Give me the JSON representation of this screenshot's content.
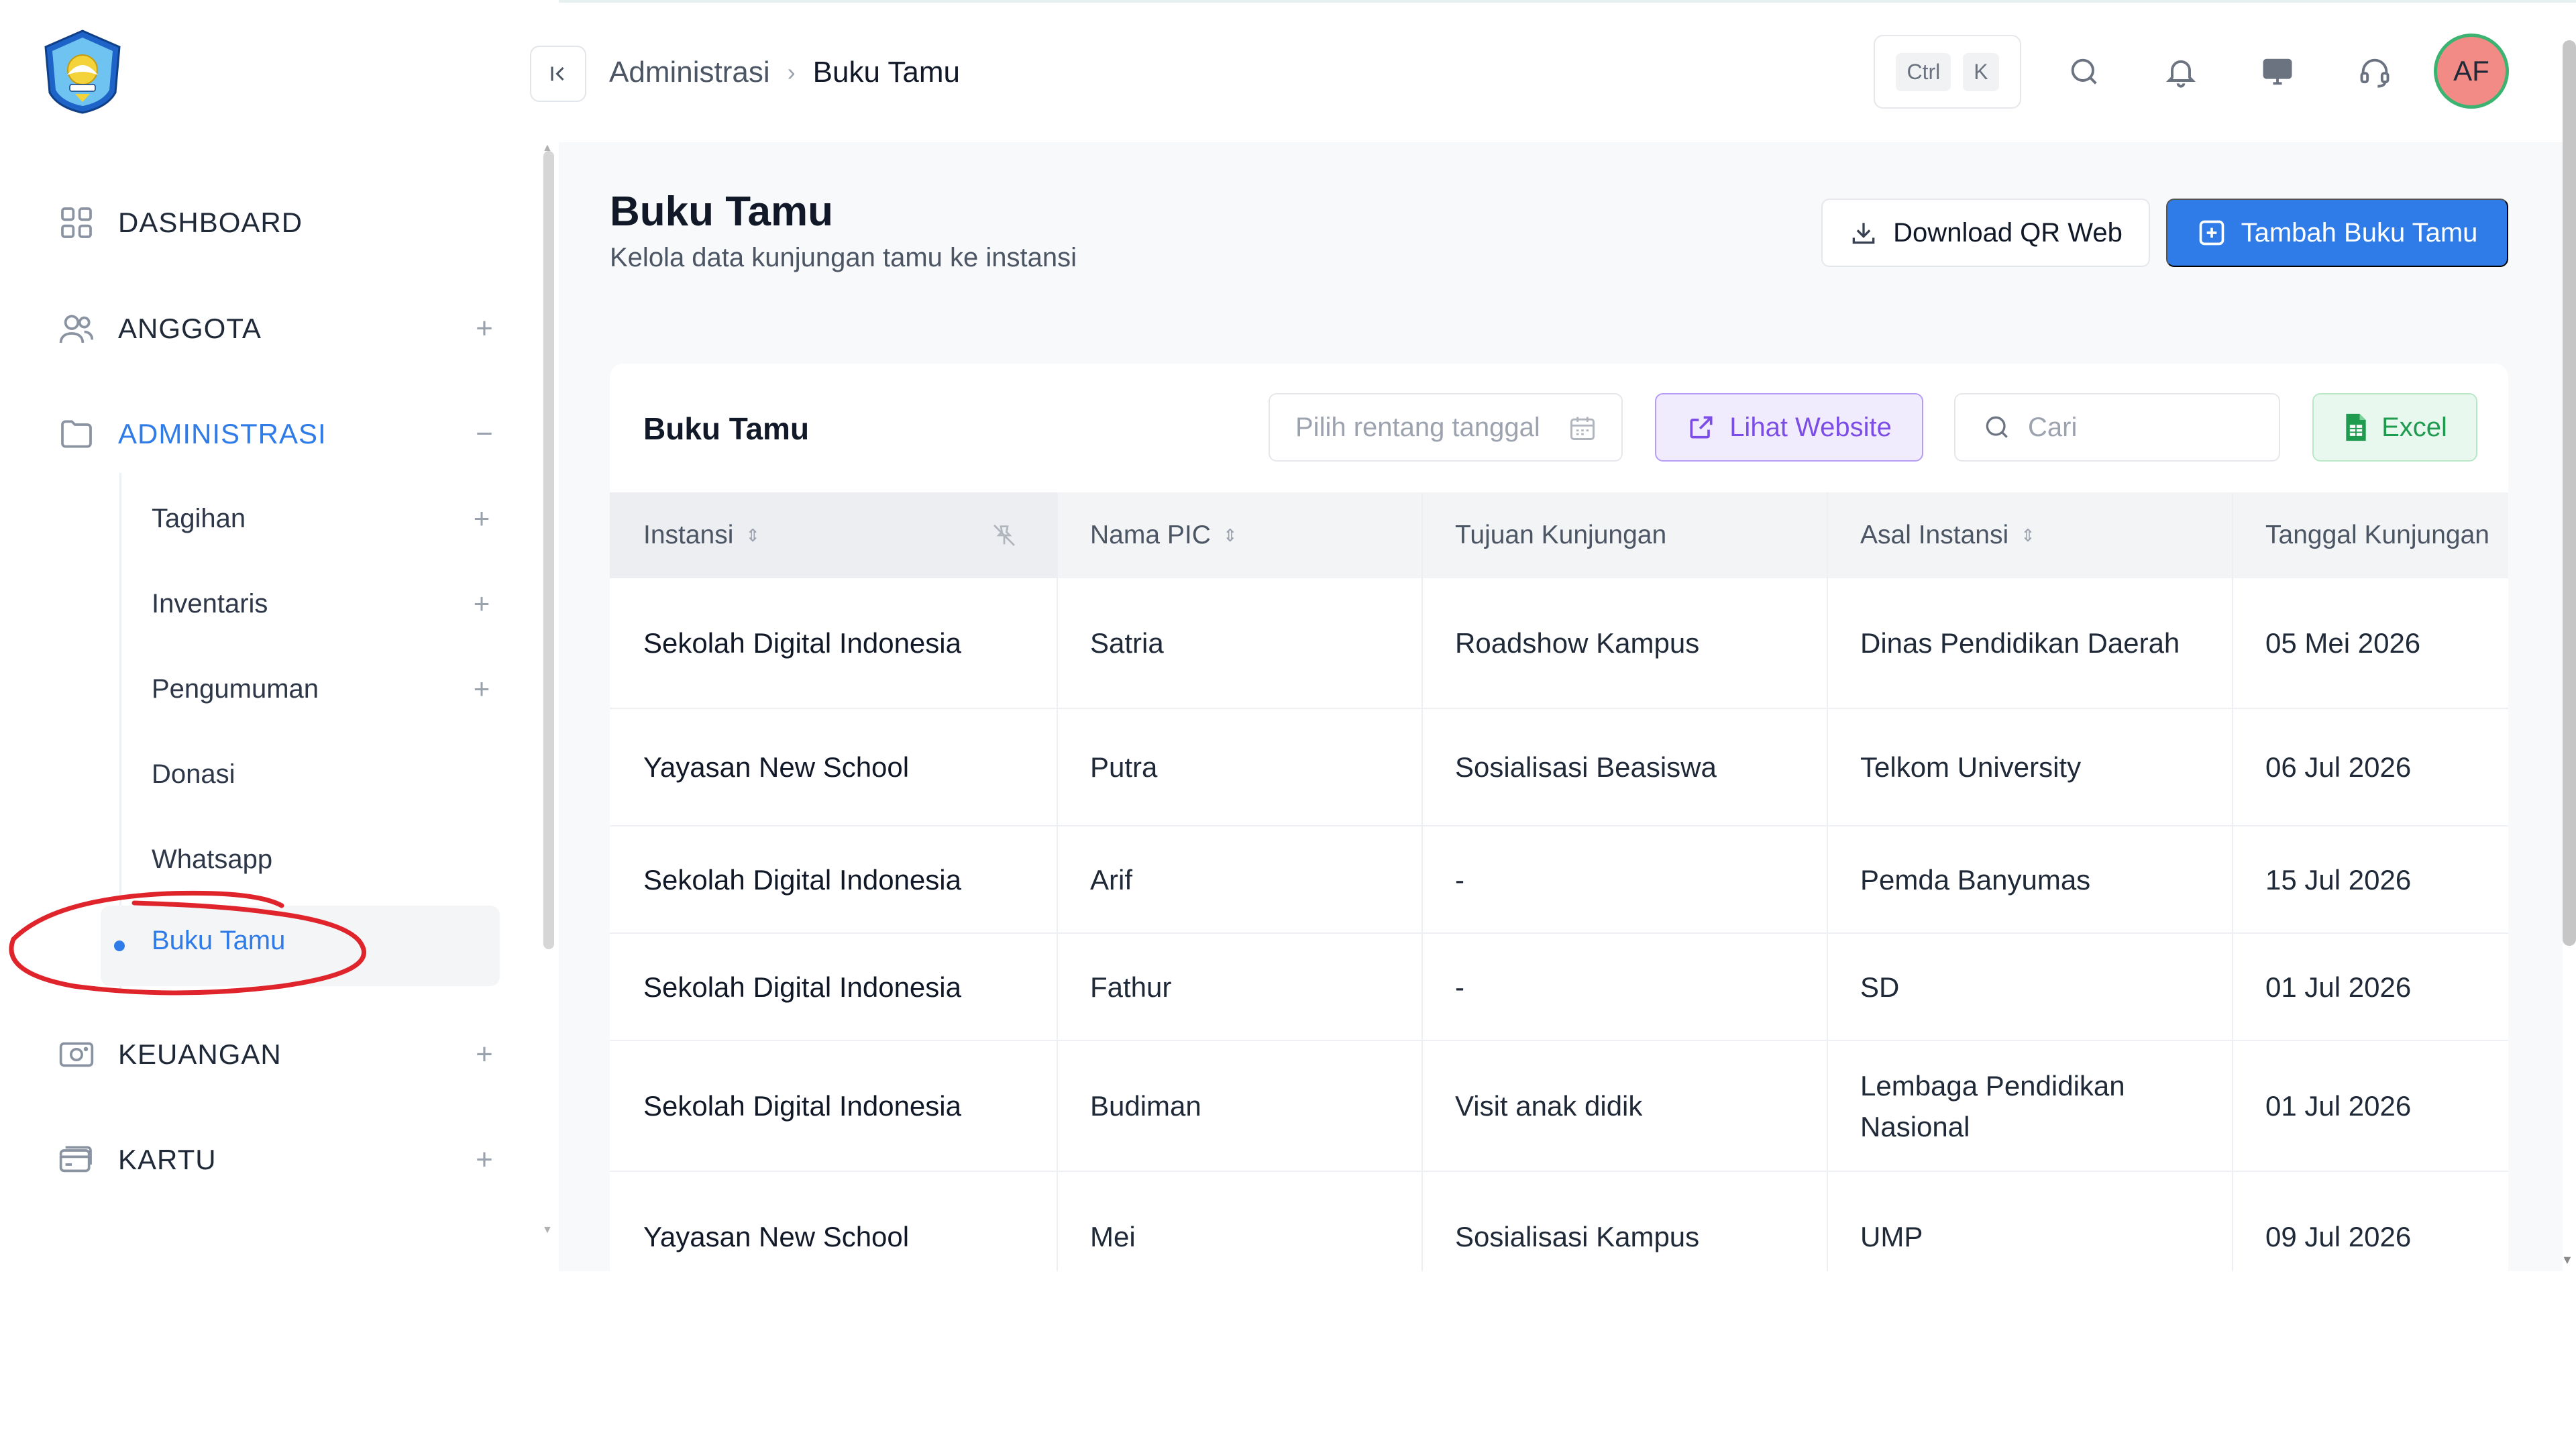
{
  "header": {
    "breadcrumb": [
      "Administrasi",
      "Buku Tamu"
    ],
    "shortcut": [
      "Ctrl",
      "K"
    ],
    "avatar_initials": "AF",
    "icons": [
      "search-icon",
      "bell-icon",
      "monitor-icon",
      "headset-icon"
    ]
  },
  "sidebar": {
    "items": [
      {
        "label": "DASHBOARD",
        "icon": "grid-icon"
      },
      {
        "label": "ANGGOTA",
        "icon": "users-icon",
        "expand": "+"
      },
      {
        "label": "ADMINISTRASI",
        "icon": "folder-icon",
        "expand": "−"
      },
      {
        "label": "KEUANGAN",
        "icon": "camera-icon",
        "expand": "+"
      },
      {
        "label": "KARTU",
        "icon": "card-icon",
        "expand": "+"
      }
    ],
    "subitems": [
      {
        "label": "Tagihan",
        "expand": "+"
      },
      {
        "label": "Inventaris",
        "expand": "+"
      },
      {
        "label": "Pengumuman",
        "expand": "+"
      },
      {
        "label": "Donasi"
      },
      {
        "label": "Whatsapp"
      }
    ],
    "active_subitem": "Buku Tamu"
  },
  "page": {
    "title": "Buku Tamu",
    "subtitle": "Kelola data kunjungan tamu ke instansi",
    "download_qr_label": "Download QR Web",
    "add_label": "Tambah Buku Tamu"
  },
  "table": {
    "title": "Buku Tamu",
    "date_placeholder": "Pilih rentang tanggal",
    "website_label": "Lihat Website",
    "search_placeholder": "Cari",
    "excel_label": "Excel",
    "columns": [
      "Instansi",
      "Nama PIC",
      "Tujuan Kunjungan",
      "Asal Instansi",
      "Tanggal Kunjungan"
    ],
    "rows": [
      [
        "Sekolah Digital Indonesia",
        "Satria",
        "Roadshow Kampus",
        "Dinas Pendidikan Daerah",
        "05 Mei 2026"
      ],
      [
        "Yayasan New School",
        "Putra",
        "Sosialisasi Beasiswa",
        "Telkom University",
        "06 Jul 2026"
      ],
      [
        "Sekolah Digital Indonesia",
        "Arif",
        "-",
        "Pemda Banyumas",
        "15 Jul 2026"
      ],
      [
        "Sekolah Digital Indonesia",
        "Fathur",
        "-",
        "SD",
        "01 Jul 2026"
      ],
      [
        "Sekolah Digital Indonesia",
        "Budiman",
        "Visit anak didik",
        "Lembaga Pendidikan Nasional",
        "01 Jul 2026"
      ],
      [
        "Yayasan New School",
        "Mei",
        "Sosialisasi Kampus",
        "UMP",
        "09 Jul 2026"
      ]
    ]
  },
  "colors": {
    "accent": "#2f7be8",
    "web_button": "#7c4de6",
    "excel_button": "#1e9b4f",
    "annotation": "#e0242b"
  }
}
